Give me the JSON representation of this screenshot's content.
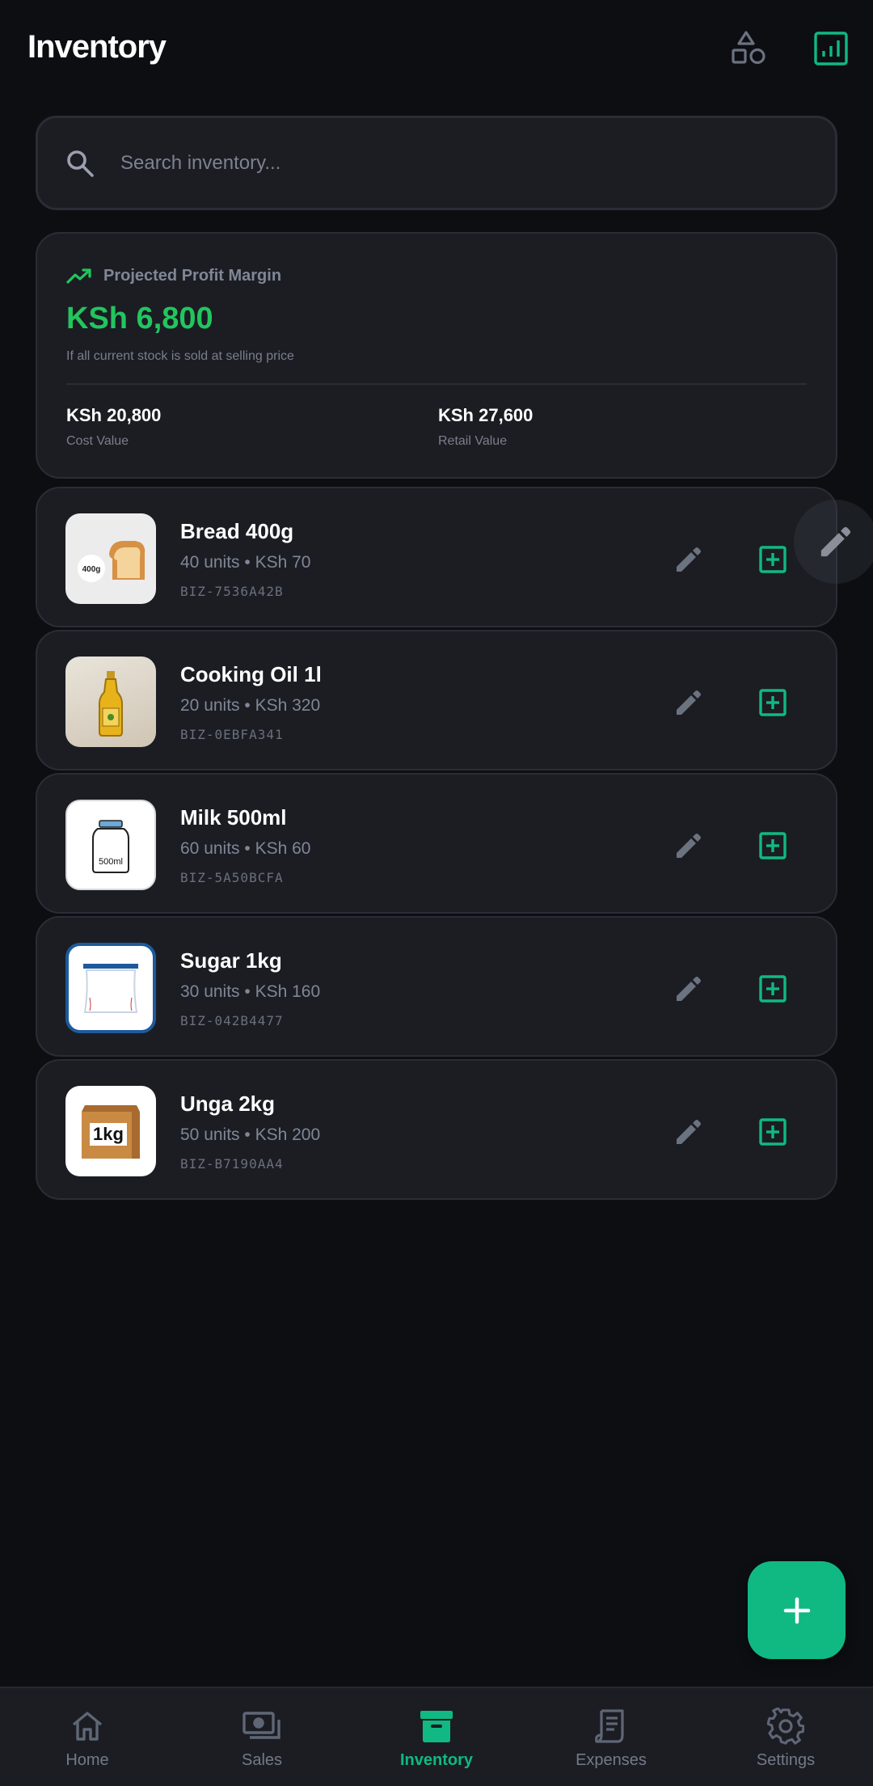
{
  "header": {
    "title": "Inventory",
    "categories_icon": "shapes-icon",
    "reports_icon": "chart-icon"
  },
  "search": {
    "placeholder": "Search inventory...",
    "value": ""
  },
  "profit_card": {
    "label": "Projected Profit Margin",
    "value": "KSh 6,800",
    "note": "If all current stock is sold at selling price",
    "cost_value": "KSh 20,800",
    "cost_label": "Cost Value",
    "retail_value": "KSh 27,600",
    "retail_label": "Retail Value"
  },
  "items": [
    {
      "name": "Bread 400g",
      "meta": "40 units • KSh 70",
      "sku": "BIZ-7536A42B",
      "image": "bread-image",
      "image_text": "400g"
    },
    {
      "name": "Cooking Oil 1l",
      "meta": "20 units • KSh 320",
      "sku": "BIZ-0EBFA341",
      "image": "oil-bottle-image"
    },
    {
      "name": "Milk 500ml",
      "meta": "60 units • KSh 60",
      "sku": "BIZ-5A50BCFA",
      "image": "milk-jar-image",
      "image_text": "500ml"
    },
    {
      "name": "Sugar 1kg",
      "meta": "30 units • KSh 160",
      "sku": "BIZ-042B4477",
      "image": "sugar-bag-image"
    },
    {
      "name": "Unga 2kg",
      "meta": "50 units • KSh 200",
      "sku": "BIZ-B7190AA4",
      "image": "flour-box-image",
      "image_text": "1kg"
    }
  ],
  "nav": {
    "items": [
      {
        "label": "Home",
        "icon": "home-icon"
      },
      {
        "label": "Sales",
        "icon": "cash-icon"
      },
      {
        "label": "Inventory",
        "icon": "archive-icon"
      },
      {
        "label": "Expenses",
        "icon": "receipt-icon"
      },
      {
        "label": "Settings",
        "icon": "gear-icon"
      }
    ],
    "active": "Inventory"
  },
  "colors": {
    "background": "#0c0e12",
    "card": "#1b1d23",
    "accent": "#10b981",
    "profit": "#22c55e",
    "muted": "#7f8796"
  }
}
